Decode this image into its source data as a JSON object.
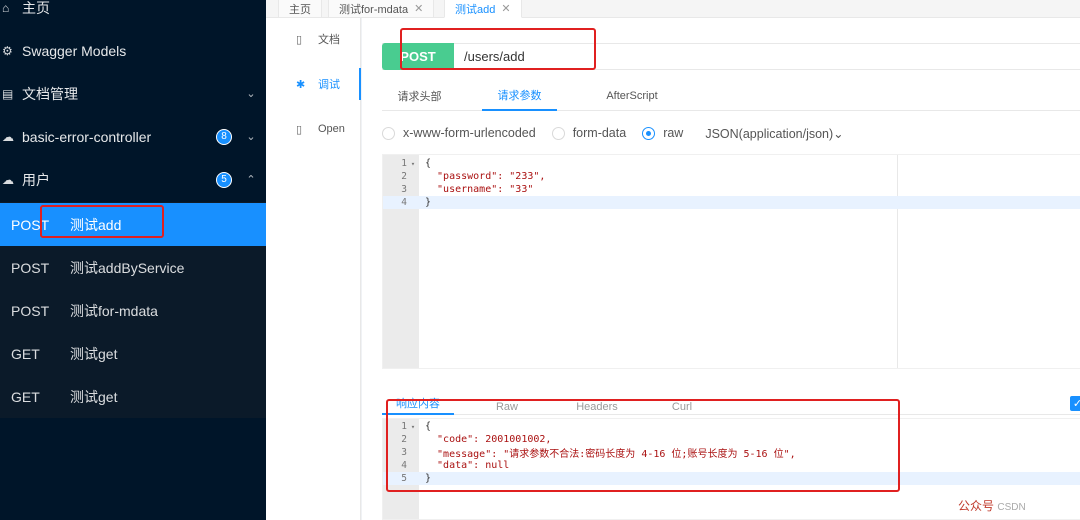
{
  "sidebar": {
    "items": [
      {
        "icon": "home-icon",
        "glyph": "⌂",
        "label": "主页",
        "arrow": "",
        "badge": ""
      },
      {
        "icon": "box-icon",
        "glyph": "⚙",
        "label": "Swagger Models",
        "arrow": "",
        "badge": ""
      },
      {
        "icon": "document-icon",
        "glyph": "▤",
        "label": "文档管理",
        "arrow": "⌄",
        "badge": ""
      },
      {
        "icon": "cloud-icon",
        "glyph": "☁",
        "label": "basic-error-controller",
        "arrow": "⌄",
        "badge": "8"
      },
      {
        "icon": "cloud-icon",
        "glyph": "☁",
        "label": "用户",
        "arrow": "⌃",
        "badge": "5"
      }
    ],
    "endpoints": [
      {
        "method": "POST",
        "name": "测试add"
      },
      {
        "method": "POST",
        "name": "测试addByService"
      },
      {
        "method": "POST",
        "name": "测试for-mdata"
      },
      {
        "method": "GET",
        "name": "测试get"
      },
      {
        "method": "GET",
        "name": "测试get"
      }
    ]
  },
  "tabs": [
    {
      "label": "主页",
      "close": ""
    },
    {
      "label": "测试for-mdata",
      "close": "✕"
    },
    {
      "label": "测试add",
      "close": "✕"
    }
  ],
  "inner_nav": [
    {
      "icon": "document-icon",
      "glyph": "▯",
      "label": "文档"
    },
    {
      "icon": "bug-icon",
      "glyph": "✱",
      "label": "调试"
    },
    {
      "icon": "file-icon",
      "glyph": "▯",
      "label": "Open"
    }
  ],
  "request": {
    "method": "POST",
    "url": "/users/add",
    "tabs": [
      "请求头部",
      "请求参数",
      "AfterScript"
    ],
    "body_types": [
      "x-www-form-urlencoded",
      "form-data",
      "raw"
    ],
    "content_type": "JSON(application/json)⌄"
  },
  "request_body": {
    "lines": [
      {
        "n": "1",
        "fold": "▾",
        "text": "{"
      },
      {
        "n": "2",
        "fold": "",
        "text": "  \"password\": \"233\","
      },
      {
        "n": "3",
        "fold": "",
        "text": "  \"username\": \"33\""
      },
      {
        "n": "4",
        "fold": "",
        "text": "}"
      }
    ]
  },
  "response": {
    "tabs": [
      "响应内容",
      "Raw",
      "Headers",
      "Curl"
    ],
    "lines": [
      {
        "n": "1",
        "fold": "▾",
        "text": "{"
      },
      {
        "n": "2",
        "fold": "",
        "text": "  \"code\": 2001001002,"
      },
      {
        "n": "3",
        "fold": "",
        "text": "  \"message\": \"请求参数不合法:密码长度为 4-16 位;账号长度为 5-16 位\","
      },
      {
        "n": "4",
        "fold": "",
        "text": "  \"data\": null"
      },
      {
        "n": "5",
        "fold": "",
        "text": "}"
      }
    ]
  },
  "watermark": {
    "text": "公众号",
    "suffix": "CSDN"
  },
  "colors": {
    "accent": "#1890ff",
    "post": "#49cc90",
    "sidebar": "#001529",
    "annotation": "#e02020"
  }
}
